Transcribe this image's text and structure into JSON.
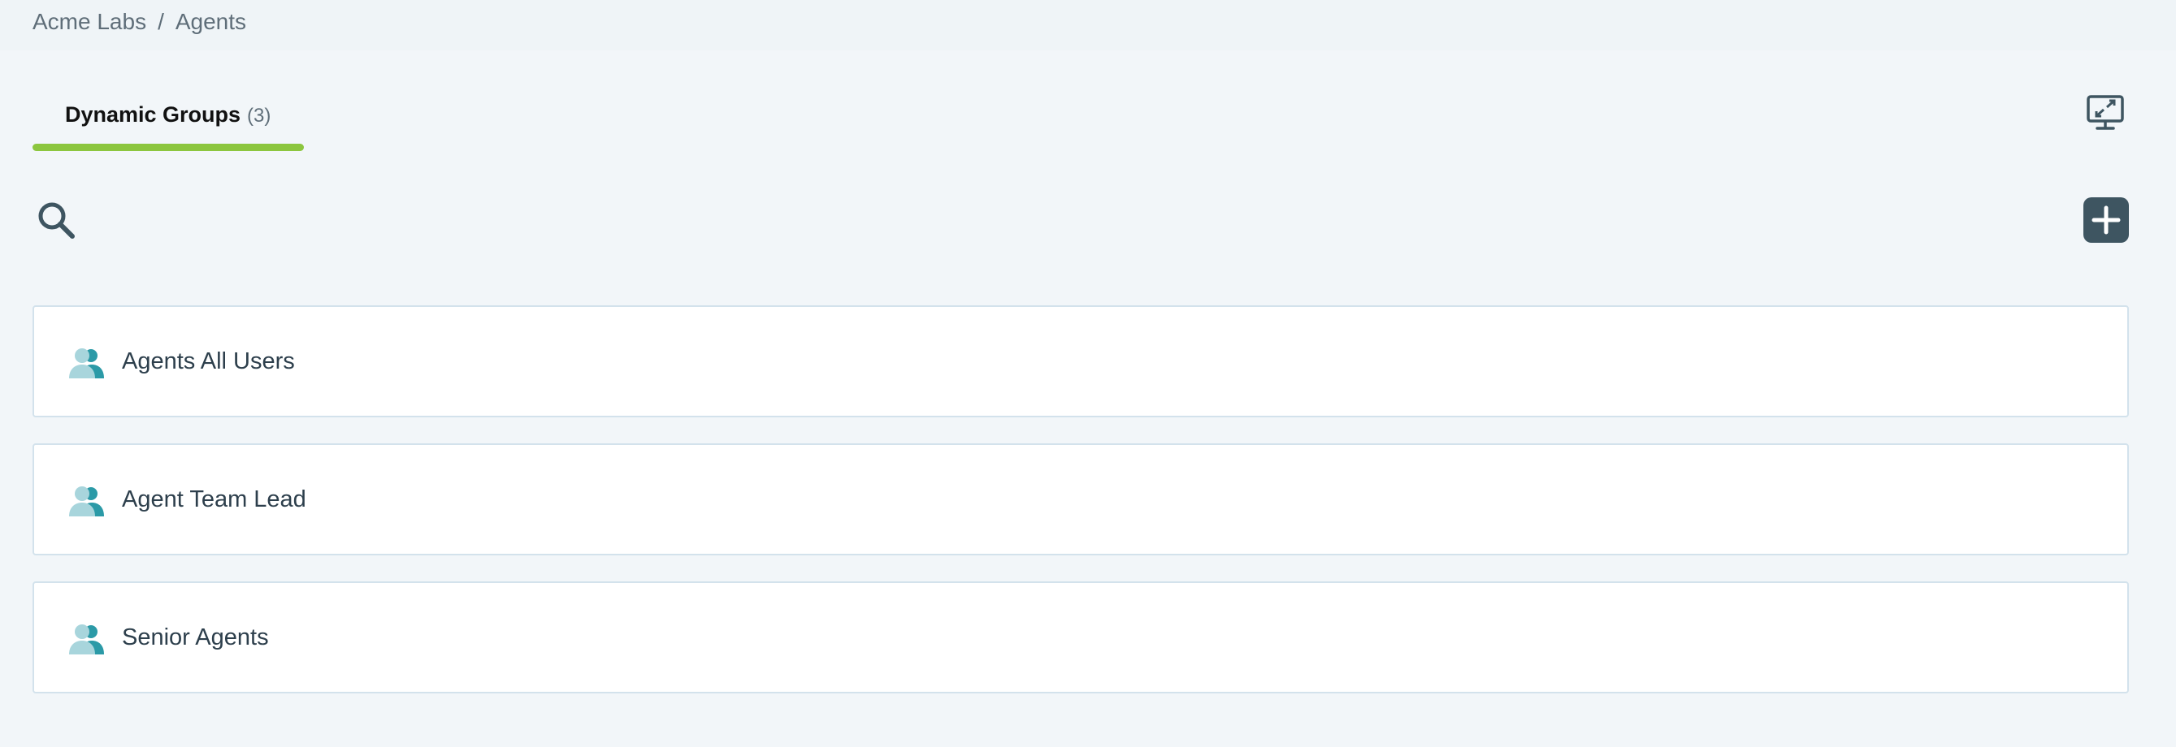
{
  "breadcrumb": {
    "org": "Acme Labs",
    "separator": "/",
    "current": "Agents"
  },
  "tabs": [
    {
      "label": "Dynamic Groups",
      "count": "(3)",
      "active": true
    }
  ],
  "toolbar": {
    "search_icon": "search-icon",
    "add_icon": "plus-icon",
    "screen_icon": "monitor-expand-icon"
  },
  "groups": [
    {
      "name": "Agents All Users",
      "icon": "users-icon"
    },
    {
      "name": "Agent Team Lead",
      "icon": "users-icon"
    },
    {
      "name": "Senior Agents",
      "icon": "users-icon"
    }
  ],
  "colors": {
    "accent": "#8cc63f",
    "add_button": "#3e5561",
    "icon_light": "#a8d5dc",
    "icon_dark": "#2b9aa7"
  }
}
